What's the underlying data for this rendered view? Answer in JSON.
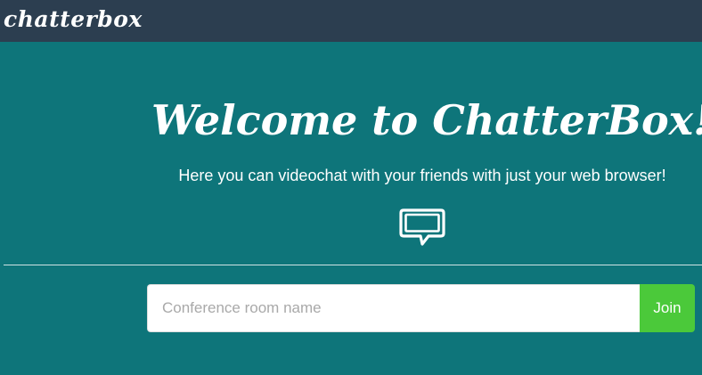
{
  "navbar": {
    "brand": "chatterbox"
  },
  "hero": {
    "title": "Welcome to ChatterBox!",
    "subtitle": "Here you can videochat with your friends with just your web browser!",
    "icon": "chat-bubble-icon"
  },
  "join_form": {
    "room_placeholder": "Conference room name",
    "room_value": "",
    "join_label": "Join"
  },
  "colors": {
    "navbar_bg": "#2c3e50",
    "page_bg": "#0e757a",
    "join_button": "#4bc93a",
    "text": "#ffffff"
  }
}
